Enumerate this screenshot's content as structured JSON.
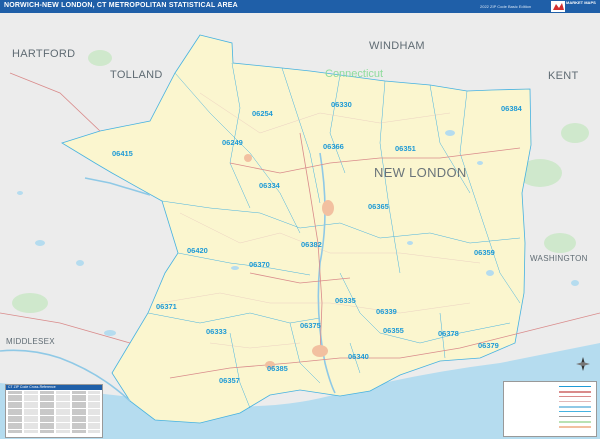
{
  "header": {
    "title": "NORWICH-NEW LONDON, CT METROPOLITAN STATISTICAL AREA",
    "edition": "2022 ZIP Code Basic Edition",
    "logo_text": "MARKET MAPS"
  },
  "map": {
    "regions": [
      {
        "name": "HARTFORD"
      },
      {
        "name": "TOLLAND"
      },
      {
        "name": "WINDHAM"
      },
      {
        "name": "KENT"
      },
      {
        "name": "WASHINGTON"
      },
      {
        "name": "MIDDLESEX"
      }
    ],
    "state_label": "Connecticut",
    "county_label": "NEW LONDON",
    "zip_labels": [
      "06415",
      "06249",
      "06254",
      "06330",
      "06384",
      "06366",
      "06351",
      "06334",
      "06365",
      "06382",
      "06420",
      "06370",
      "06359",
      "06371",
      "06335",
      "06339",
      "06333",
      "06375",
      "06355",
      "06378",
      "06379",
      "06340",
      "06385",
      "06357"
    ],
    "colors": {
      "header": "#1f5fa8",
      "msa_fill": "#fbf6cf",
      "outside": "#eaeaea",
      "water": "#b5dcef",
      "zip_label": "#1e9ad6",
      "zip_boundary": "#46b2e0",
      "roads": "#d98b8b",
      "forest": "#b9e2b4"
    }
  },
  "legend": {
    "header": "CT ZIP Code Cross-Reference"
  }
}
